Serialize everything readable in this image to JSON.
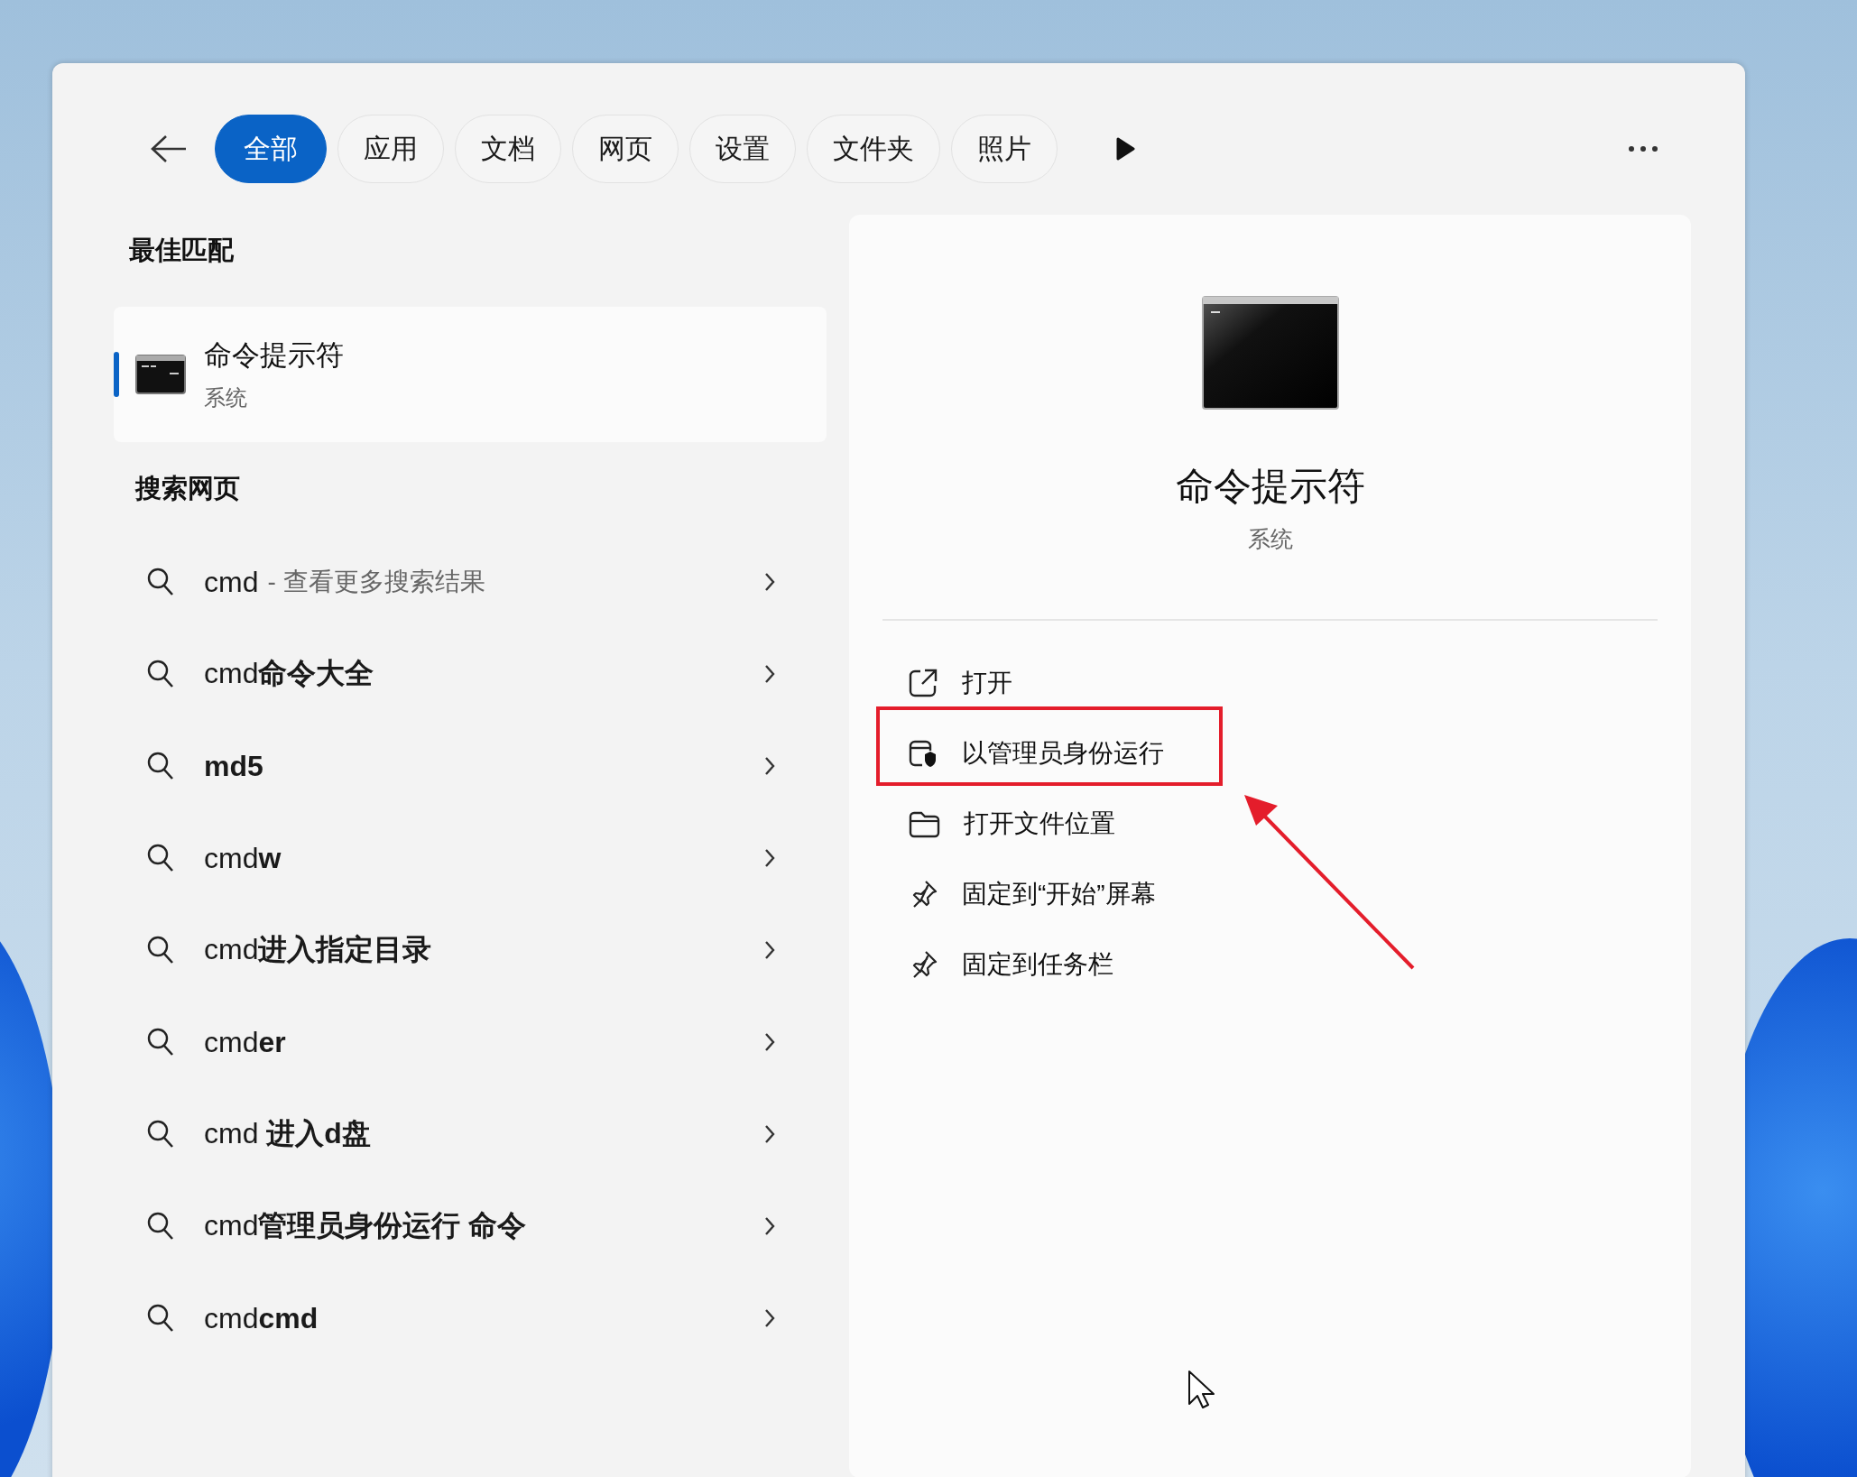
{
  "tabs": [
    {
      "label": "全部",
      "selected": true
    },
    {
      "label": "应用",
      "selected": false
    },
    {
      "label": "文档",
      "selected": false
    },
    {
      "label": "网页",
      "selected": false
    },
    {
      "label": "设置",
      "selected": false
    },
    {
      "label": "文件夹",
      "selected": false
    },
    {
      "label": "照片",
      "selected": false
    }
  ],
  "best_match": {
    "heading": "最佳匹配",
    "title": "命令提示符",
    "subtitle": "系统",
    "selected": true
  },
  "web_search": {
    "heading": "搜索网页",
    "items": [
      {
        "text": "cmd",
        "hint": "- 查看更多搜索结果"
      },
      {
        "text": "cmd**命令大全**"
      },
      {
        "text": "**md5**"
      },
      {
        "text": "cmd**w**"
      },
      {
        "text": "cmd**进入指定目录**"
      },
      {
        "text": "cmd**er**"
      },
      {
        "text": "cmd **进入d盘**"
      },
      {
        "text": "cmd**管理员身份运行 命令**"
      },
      {
        "text": "cmd**cmd**"
      }
    ]
  },
  "details": {
    "title": "命令提示符",
    "subtitle": "系统",
    "actions": [
      {
        "kind": "open",
        "label": "打开",
        "highlighted": false
      },
      {
        "kind": "admin",
        "label": "以管理员身份运行",
        "highlighted": true
      },
      {
        "kind": "folder",
        "label": "打开文件位置",
        "highlighted": false
      },
      {
        "kind": "pin",
        "label": "固定到“开始”屏幕",
        "highlighted": false
      },
      {
        "kind": "pin",
        "label": "固定到任务栏",
        "highlighted": false
      }
    ]
  }
}
